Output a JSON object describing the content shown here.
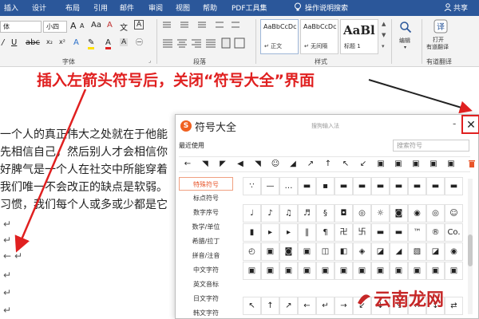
{
  "ribbon_tabs": [
    "插入",
    "设计",
    "布局",
    "引用",
    "邮件",
    "审阅",
    "视图",
    "帮助",
    "PDF工具集"
  ],
  "tell_me": "操作说明搜索",
  "share": "共享",
  "font": {
    "font_name": "体",
    "font_size": "小四",
    "grow": "A",
    "shrink": "A",
    "case": "Aa",
    "clear": "A",
    "wen": "文",
    "a_box": "A",
    "group_label": "字体"
  },
  "paragraph": {
    "group_label": "段落"
  },
  "styles": {
    "group_label": "样式",
    "items": [
      {
        "sample": "AaBbCcDc",
        "name": "↵ 正文"
      },
      {
        "sample": "AaBbCcDc",
        "name": "↵ 无间隔"
      },
      {
        "sample": "AaBl",
        "name": "标题 1"
      }
    ]
  },
  "editing": {
    "label": "编辑"
  },
  "translate": {
    "label1": "打开",
    "label2": "有道翻译",
    "label3": "有道翻译"
  },
  "annotation": "插入左箭头符号后，关闭“符号大全”界面",
  "document": {
    "lines": [
      "一个人的真正伟大之处就在于他能",
      "先相信自己，然后别人才会相信你",
      "好脾气是一个人在社交中所能穿着",
      "我们唯一不会改正的缺点是软弱。",
      "习惯，我们每个人或多或少都是它"
    ],
    "arrow_glyph": "←",
    "para_mark": "↵"
  },
  "dialog": {
    "title": "符号大全",
    "subtitle": "搜狗输入法",
    "minimize": "-",
    "close": "✕",
    "recent_label": "最近使用",
    "search_placeholder": "搜索符号",
    "recent_symbols": [
      "←",
      "◥",
      "◤",
      "◀",
      "◥",
      "☺",
      "◢",
      "↗",
      "↑",
      "↖",
      "↙",
      "▣",
      "▣",
      "▣",
      "▣",
      "▣"
    ],
    "categories": [
      "特殊符号",
      "标点符号",
      "数字序号",
      "数学/单位",
      "希腊/拉丁",
      "拼音/注音",
      "中文字符",
      "英文音标",
      "日文字符",
      "韩文字符"
    ],
    "grid": [
      [
        "∵",
        "—",
        "…",
        "▬",
        "▪",
        "▬",
        "▬",
        "▬",
        "▬",
        "▬",
        "▬",
        "▬"
      ],
      [
        "♩",
        "♪",
        "♫",
        "♬",
        "§",
        "◘",
        "◎",
        "☼",
        "◙",
        "◉",
        "◎",
        "☺"
      ],
      [
        "▮",
        "▸",
        "▸",
        "‖",
        "¶",
        "卍",
        "卐",
        "▬",
        "▬",
        "™",
        "®",
        "Co."
      ],
      [
        "◴",
        "▣",
        "◙",
        "▣",
        "◫",
        "◧",
        "◈",
        "◪",
        "◢",
        "▧",
        "◪",
        "◉"
      ],
      [
        "▣",
        "▣",
        "▣",
        "▣",
        "▣",
        "▣",
        "▣",
        "▣",
        "▣",
        "▣",
        "▣",
        "▣"
      ],
      [
        "↖",
        "↑",
        "↗",
        "←",
        "↵",
        "→",
        "↙",
        "↓",
        "↘",
        "↔",
        "↕",
        "⇄"
      ]
    ]
  },
  "watermark": "云南龙网"
}
